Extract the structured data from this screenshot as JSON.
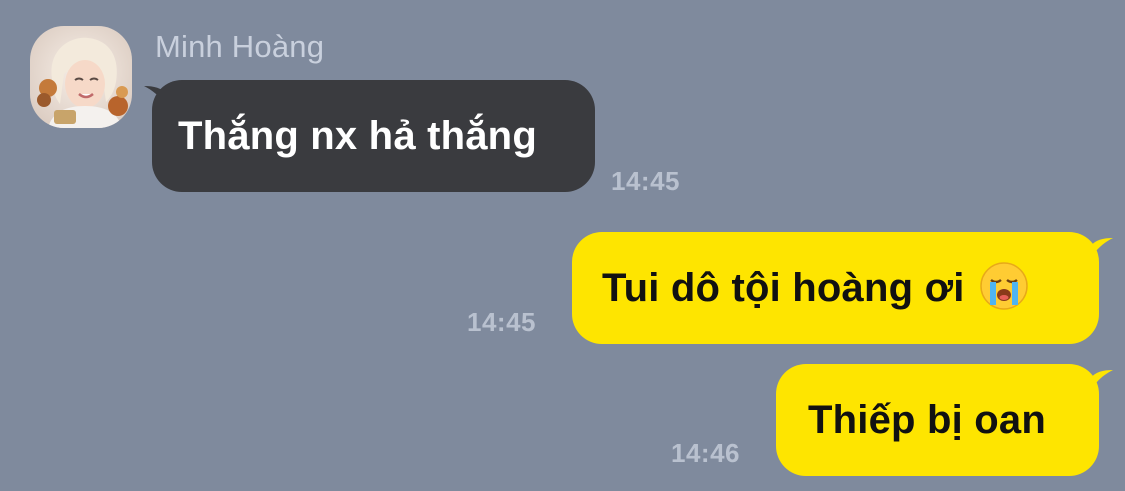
{
  "chat": {
    "sender": {
      "name": "Minh Hoàng",
      "avatar": "avatar-photo"
    },
    "messages": [
      {
        "direction": "incoming",
        "text": "Thắng nx hả thắng",
        "time": "14:45"
      },
      {
        "direction": "outgoing",
        "text": "Tui dô tội hoàng ơi",
        "emoji": "loudly-crying-face-icon",
        "time": "14:45"
      },
      {
        "direction": "outgoing",
        "text": "Thiếp bị oan",
        "time": "14:46"
      }
    ]
  },
  "colors": {
    "background": "#7f8a9d",
    "incoming_bubble": "#3a3b3f",
    "outgoing_bubble": "#fee500",
    "timestamp": "#b9c1cf",
    "sender_name": "#c9d0dd"
  }
}
